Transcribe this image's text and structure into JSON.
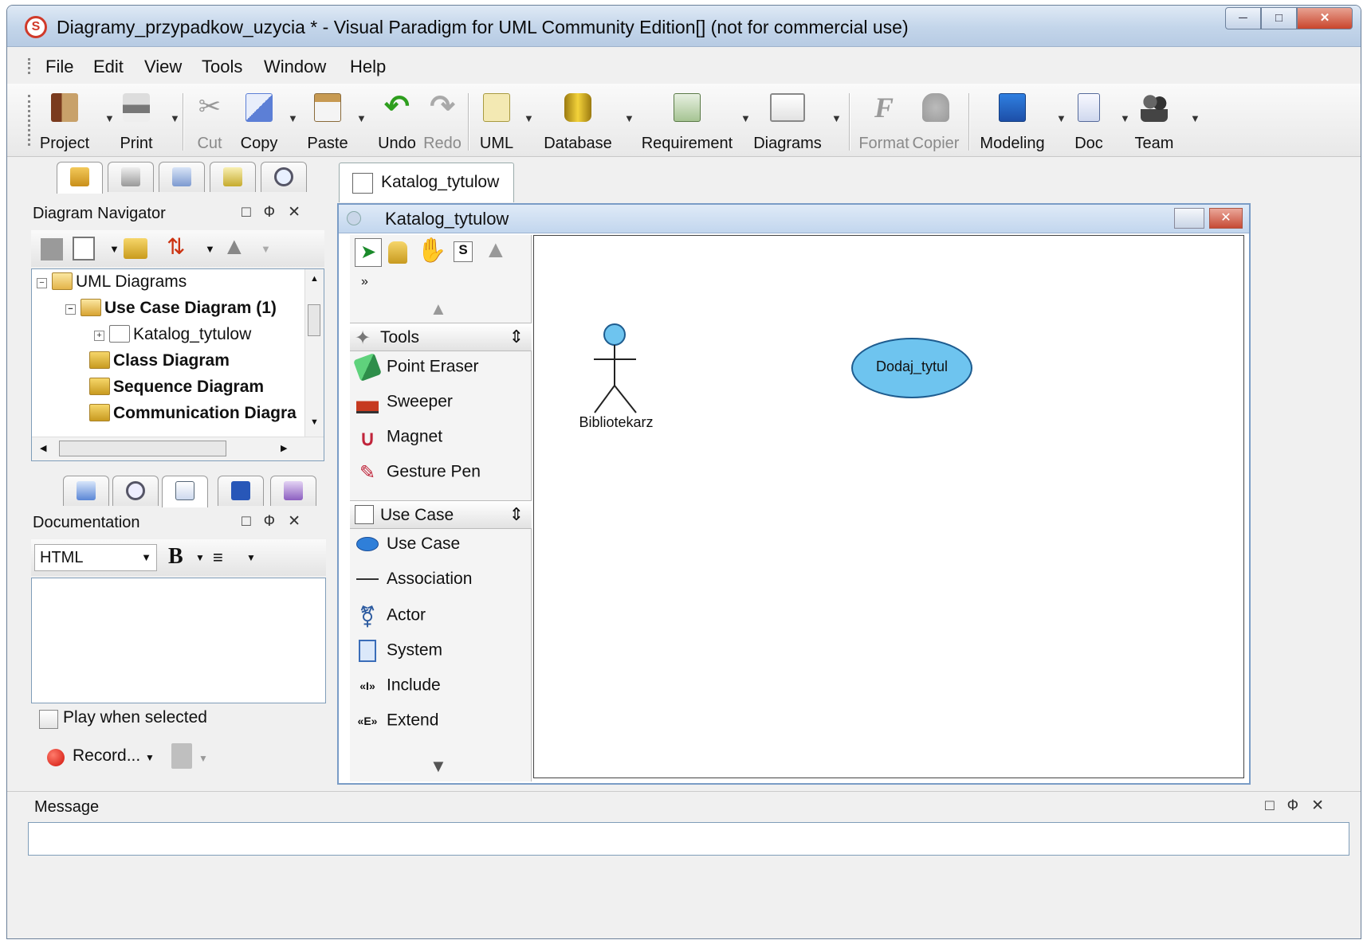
{
  "window": {
    "title": "Diagramy_przypadkow_uzycia * - Visual Paradigm for UML Community Edition[] (not for commercial use)"
  },
  "menu": [
    {
      "label": "File"
    },
    {
      "label": "Edit"
    },
    {
      "label": "View"
    },
    {
      "label": "Tools"
    },
    {
      "label": "Window"
    },
    {
      "label": "Help"
    }
  ],
  "toolbar": {
    "project": "Project",
    "print": "Print",
    "cut": "Cut",
    "copy": "Copy",
    "paste": "Paste",
    "undo": "Undo",
    "redo": "Redo",
    "uml": "UML",
    "database": "Database",
    "requirement": "Requirement",
    "diagrams": "Diagrams",
    "format": "Format",
    "copier": "Copier",
    "modeling": "Modeling",
    "doc": "Doc",
    "team": "Team"
  },
  "navigator": {
    "title": "Diagram Navigator",
    "tree": {
      "root": "UML Diagrams",
      "use_case": "Use Case Diagram (1)",
      "katalog": "Katalog_tytulow",
      "class": "Class Diagram",
      "sequence": "Sequence Diagram",
      "communication": "Communication Diagra"
    }
  },
  "documentation": {
    "title": "Documentation",
    "format_value": "HTML",
    "bold_label": "B",
    "play_label": "Play when selected",
    "record_label": "Record..."
  },
  "editor": {
    "tab_label": "Katalog_tytulow",
    "diagram_title": "Katalog_tytulow"
  },
  "palette": {
    "tools_section": "Tools",
    "usecase_section": "Use Case",
    "tools": [
      "Point Eraser",
      "Sweeper",
      "Magnet",
      "Gesture Pen"
    ],
    "usecase_items": [
      "Use Case",
      "Association",
      "Actor",
      "System",
      "Include",
      "Extend"
    ]
  },
  "diagram": {
    "actor_name": "Bibliotekarz",
    "usecase_name": "Dodaj_tytul",
    "colors": {
      "shape_fill": "#6ec4ef",
      "shape_stroke": "#1e5c8f"
    }
  },
  "message": {
    "title": "Message"
  }
}
